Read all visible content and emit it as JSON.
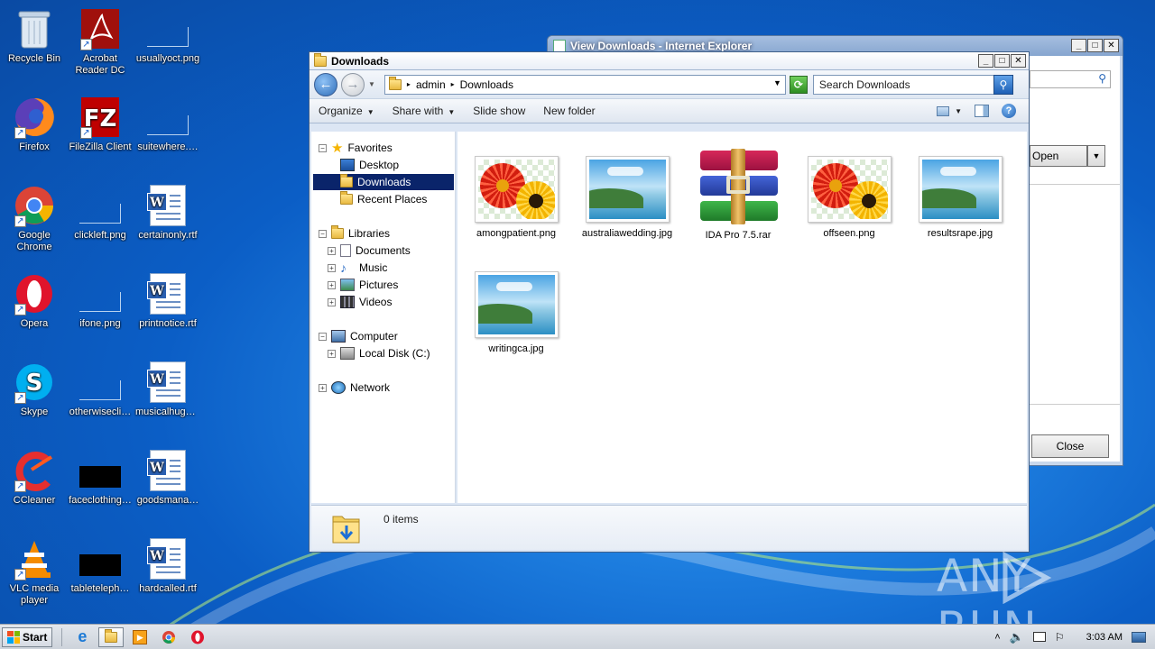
{
  "desktop": {
    "icons": [
      {
        "label": "Recycle Bin",
        "icon": "recycle-bin-icon"
      },
      {
        "label": "Acrobat Reader DC",
        "icon": "acrobat-icon"
      },
      {
        "label": "usuallyoct.png",
        "icon": "image-file-icon"
      },
      {
        "label": "Firefox",
        "icon": "firefox-icon"
      },
      {
        "label": "FileZilla Client",
        "icon": "filezilla-icon"
      },
      {
        "label": "suitewhere.…",
        "icon": "image-file-icon"
      },
      {
        "label": "Google Chrome",
        "icon": "chrome-icon"
      },
      {
        "label": "clickleft.png",
        "icon": "image-file-icon"
      },
      {
        "label": "certainonly.rtf",
        "icon": "word-file-icon"
      },
      {
        "label": "Opera",
        "icon": "opera-icon"
      },
      {
        "label": "ifone.png",
        "icon": "image-file-icon"
      },
      {
        "label": "printnotice.rtf",
        "icon": "word-file-icon"
      },
      {
        "label": "Skype",
        "icon": "skype-icon"
      },
      {
        "label": "otherwisecli…",
        "icon": "image-file-icon"
      },
      {
        "label": "musicalhuge…",
        "icon": "word-file-icon"
      },
      {
        "label": "CCleaner",
        "icon": "ccleaner-icon"
      },
      {
        "label": "faceclothing…",
        "icon": "image-file-icon"
      },
      {
        "label": "goodsmana…",
        "icon": "word-file-icon"
      },
      {
        "label": "VLC media player",
        "icon": "vlc-icon"
      },
      {
        "label": "tableteleph…",
        "icon": "image-file-icon"
      },
      {
        "label": "hardcalled.rtf",
        "icon": "word-file-icon"
      }
    ]
  },
  "ie_window": {
    "title": "View Downloads - Internet Explorer",
    "open_button": "Open",
    "close_button": "Close"
  },
  "explorer": {
    "title": "Downloads",
    "breadcrumb": [
      "admin",
      "Downloads"
    ],
    "search_placeholder": "Search Downloads",
    "toolbar": {
      "organize": "Organize",
      "share_with": "Share with",
      "slide_show": "Slide show",
      "new_folder": "New folder"
    },
    "nav": {
      "favorites": "Favorites",
      "desktop": "Desktop",
      "downloads": "Downloads",
      "recent_places": "Recent Places",
      "libraries": "Libraries",
      "documents": "Documents",
      "music": "Music",
      "pictures": "Pictures",
      "videos": "Videos",
      "computer": "Computer",
      "local_disk": "Local Disk (C:)",
      "network": "Network"
    },
    "files": [
      {
        "name": "amongpatient.png",
        "type": "flower"
      },
      {
        "name": "australiawedding.jpg",
        "type": "landscape"
      },
      {
        "name": "IDA Pro 7.5.rar",
        "type": "rar"
      },
      {
        "name": "offseen.png",
        "type": "flower"
      },
      {
        "name": "resultsrape.jpg",
        "type": "landscape"
      },
      {
        "name": "writingca.jpg",
        "type": "landscape"
      }
    ],
    "status": "0 items"
  },
  "taskbar": {
    "start_label": "Start",
    "clock": "3:03 AM"
  },
  "watermark": "ANY RUN"
}
